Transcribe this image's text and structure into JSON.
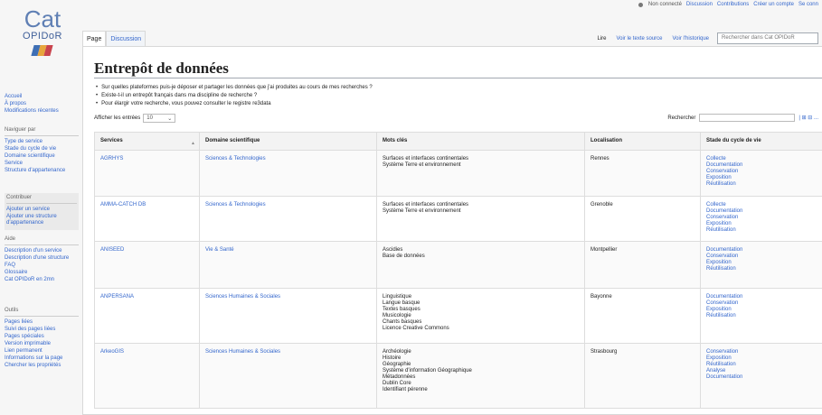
{
  "personal": {
    "not_logged": "Non connecté",
    "discussion": "Discussion",
    "contributions": "Contributions",
    "create_account": "Créer un compte",
    "login": "Se conn"
  },
  "logo": {
    "line1": "Cat",
    "line2": "OPIDoR"
  },
  "sidebar": {
    "main": [
      "Accueil",
      "À propos",
      "Modifications récentes"
    ],
    "browse_heading": "Naviguer par",
    "browse": [
      "Type de service",
      "Stade du cycle de vie",
      "Domaine scientifique",
      "Service",
      "Structure d'appartenance"
    ],
    "contrib_heading": "Contribuer",
    "contrib": [
      "Ajouter un service",
      "Ajouter une structure d'appartenance"
    ],
    "help_heading": "Aide",
    "help": [
      "Description d'un service",
      "Description d'une structure",
      "FAQ",
      "Glossaire",
      "Cat OPIDoR en 2mn"
    ],
    "tools_heading": "Outils",
    "tools": [
      "Pages liées",
      "Suivi des pages liées",
      "Pages spéciales",
      "Version imprimable",
      "Lien permanent",
      "Informations sur la page",
      "Chercher les propriétés"
    ]
  },
  "tabs": {
    "page": "Page",
    "discussion": "Discussion",
    "read": "Lire",
    "view_source": "Voir le texte source",
    "history": "Voir l'historique",
    "search_placeholder": "Rechercher dans Cat OPIDoR"
  },
  "page": {
    "title": "Entrepôt de données",
    "bullets": [
      "Sur quelles plateformes puis-je déposer et partager les données que j'ai produites au cours de mes recherches ?",
      "Existe-t-il un entrepôt français dans ma discipline de recherche ?",
      "Pour élargir votre recherche, vous pouvez consulter le registre re3data"
    ],
    "entries_label": "Afficher les entrées",
    "entries_value": "10",
    "search_label": "Rechercher",
    "search_extra": "| ⊞ ⊟ ..."
  },
  "table": {
    "headers": [
      "Services",
      "Domaine scientifique",
      "Mots clés",
      "Localisation",
      "Stade du cycle de vie"
    ],
    "rows": [
      {
        "service": "AGRHYS",
        "domain": "Sciences & Technologies",
        "keywords": [
          "Surfaces et interfaces continentales",
          "Système Terre et environnement"
        ],
        "location": "Rennes",
        "stages": [
          "Collecte",
          "Documentation",
          "Conservation",
          "Exposition",
          "Réutilisation"
        ]
      },
      {
        "service": "AMMA-CATCH DB",
        "domain": "Sciences & Technologies",
        "keywords": [
          "Surfaces et interfaces continentales",
          "Système Terre et environnement"
        ],
        "location": "Grenoble",
        "stages": [
          "Collecte",
          "Documentation",
          "Conservation",
          "Exposition",
          "Réutilisation"
        ]
      },
      {
        "service": "ANISEED",
        "domain": "Vie & Santé",
        "keywords": [
          "Ascidies",
          "Base de données"
        ],
        "location": "Montpellier",
        "stages": [
          "Documentation",
          "Conservation",
          "Exposition",
          "Réutilisation"
        ]
      },
      {
        "service": "ANPERSANA",
        "domain": "Sciences Humaines & Sociales",
        "keywords": [
          "Linguistique",
          "Langue basque",
          "Textes basques",
          "Musicologie",
          "Chants basques",
          "Licence Creative Commons"
        ],
        "location": "Bayonne",
        "stages": [
          "Documentation",
          "Conservation",
          "Exposition",
          "Réutilisation"
        ]
      },
      {
        "service": "ArkeoGIS",
        "domain": "Sciences Humaines & Sociales",
        "keywords": [
          "Archéologie",
          "Histoire",
          "Géographie",
          "Système d'information Géographique",
          "Métadonnées",
          "Dublin Core",
          "Identifiant pérenne"
        ],
        "location": "Strasbourg",
        "stages": [
          "Conservation",
          "Exposition",
          "Réutilisation",
          "Analyse",
          "Documentation"
        ]
      }
    ]
  }
}
